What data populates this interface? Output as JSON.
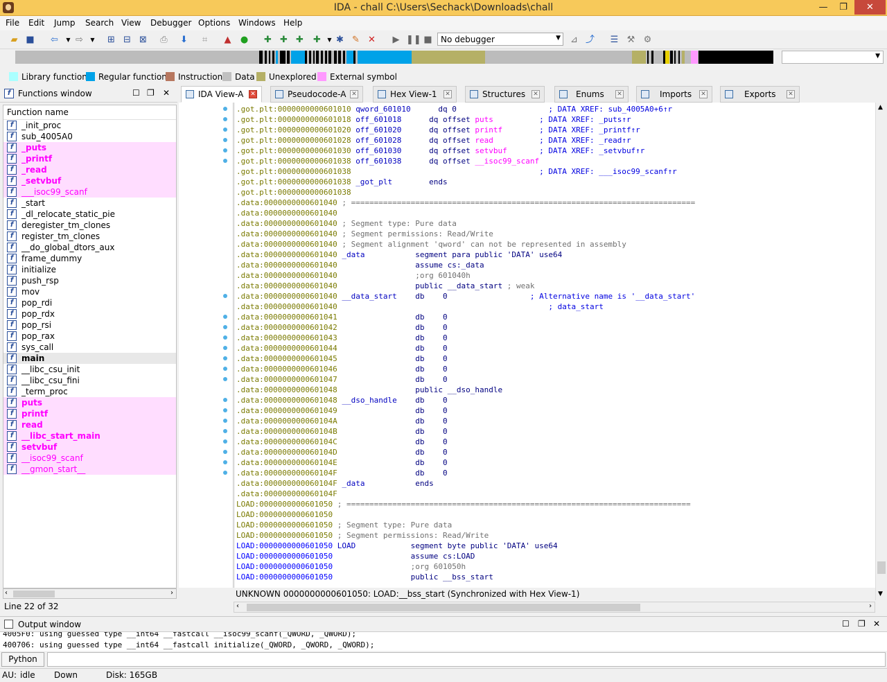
{
  "title": "IDA - chall C:\\Users\\Sechack\\Downloads\\chall",
  "window_buttons": {
    "minimize": "—",
    "maximize": "❐",
    "close": "✕"
  },
  "menu": [
    "File",
    "Edit",
    "Jump",
    "Search",
    "View",
    "Debugger",
    "Options",
    "Windows",
    "Help"
  ],
  "debugger_select": "No debugger",
  "legend": [
    {
      "label": "Library function",
      "color": "#aaffff"
    },
    {
      "label": "Regular function",
      "color": "#00a2e8"
    },
    {
      "label": "Instruction",
      "color": "#b7775f"
    },
    {
      "label": "Data",
      "color": "#c0c0c0"
    },
    {
      "label": "Unexplored",
      "color": "#b5b066"
    },
    {
      "label": "External symbol",
      "color": "#ff99ff"
    }
  ],
  "functions_window": {
    "title": "Functions window",
    "column": "Function name",
    "items": [
      {
        "name": "_init_proc",
        "kind": "reg"
      },
      {
        "name": "sub_4005A0",
        "kind": "reg"
      },
      {
        "name": "_puts",
        "kind": "ext"
      },
      {
        "name": "_printf",
        "kind": "ext"
      },
      {
        "name": "_read",
        "kind": "ext"
      },
      {
        "name": "_setvbuf",
        "kind": "ext"
      },
      {
        "name": "___isoc99_scanf",
        "kind": "ext"
      },
      {
        "name": "_start",
        "kind": "reg"
      },
      {
        "name": "_dl_relocate_static_pie",
        "kind": "reg"
      },
      {
        "name": "deregister_tm_clones",
        "kind": "reg"
      },
      {
        "name": "register_tm_clones",
        "kind": "reg"
      },
      {
        "name": "__do_global_dtors_aux",
        "kind": "reg"
      },
      {
        "name": "frame_dummy",
        "kind": "reg"
      },
      {
        "name": "initialize",
        "kind": "reg"
      },
      {
        "name": "push_rsp",
        "kind": "reg"
      },
      {
        "name": "mov",
        "kind": "reg"
      },
      {
        "name": "pop_rdi",
        "kind": "reg"
      },
      {
        "name": "pop_rdx",
        "kind": "reg"
      },
      {
        "name": "pop_rsi",
        "kind": "reg"
      },
      {
        "name": "pop_rax",
        "kind": "reg"
      },
      {
        "name": "sys_call",
        "kind": "reg"
      },
      {
        "name": "main",
        "kind": "sel"
      },
      {
        "name": "__libc_csu_init",
        "kind": "reg"
      },
      {
        "name": "__libc_csu_fini",
        "kind": "reg"
      },
      {
        "name": "_term_proc",
        "kind": "reg"
      },
      {
        "name": "puts",
        "kind": "ext"
      },
      {
        "name": "printf",
        "kind": "ext"
      },
      {
        "name": "read",
        "kind": "ext"
      },
      {
        "name": "__libc_start_main",
        "kind": "ext"
      },
      {
        "name": "setvbuf",
        "kind": "ext"
      },
      {
        "name": "__isoc99_scanf",
        "kind": "ext"
      },
      {
        "name": "__gmon_start__",
        "kind": "ext"
      }
    ],
    "status": "Line 22 of 32"
  },
  "tabs": [
    "IDA View-A",
    "Pseudocode-A",
    "Hex View-1",
    "Structures",
    "Enums",
    "Imports",
    "Exports"
  ],
  "disasm": [
    [
      ".got.plt:0000000000601010 ",
      "qword_601010",
      "      dq 0                    ",
      "; DATA XREF: sub_4005A0+6↑r"
    ],
    [
      ".got.plt:0000000000601018 ",
      "off_601018",
      "      dq offset puts          ",
      "; DATA XREF: _puts↑r"
    ],
    [
      ".got.plt:0000000000601020 ",
      "off_601020",
      "      dq offset printf        ",
      "; DATA XREF: _printf↑r"
    ],
    [
      ".got.plt:0000000000601028 ",
      "off_601028",
      "      dq offset read          ",
      "; DATA XREF: _read↑r"
    ],
    [
      ".got.plt:0000000000601030 ",
      "off_601030",
      "      dq offset setvbuf       ",
      "; DATA XREF: _setvbuf↑r"
    ],
    [
      ".got.plt:0000000000601038 ",
      "off_601038",
      "      dq offset __isoc99_scanf",
      ""
    ],
    [
      ".got.plt:0000000000601038 ",
      "",
      "                                        ",
      "; DATA XREF: ___isoc99_scanf↑r"
    ],
    [
      ".got.plt:0000000000601038 ",
      "_got_plt",
      "        ends",
      ""
    ],
    [
      ".got.plt:0000000000601038",
      "",
      "",
      ""
    ],
    [
      ".data:0000000000601040 ",
      "",
      "",
      "; ==========================================================================="
    ],
    [
      ".data:0000000000601040",
      "",
      "",
      ""
    ],
    [
      ".data:0000000000601040 ",
      "",
      "",
      "; Segment type: Pure data"
    ],
    [
      ".data:0000000000601040 ",
      "",
      "",
      "; Segment permissions: Read/Write"
    ],
    [
      ".data:0000000000601040 ",
      "",
      "",
      "; Segment alignment 'qword' can not be represented in assembly"
    ],
    [
      ".data:0000000000601040 ",
      "_data",
      "           segment para public 'DATA' use64",
      ""
    ],
    [
      ".data:0000000000601040 ",
      "",
      "                assume cs:_data",
      ""
    ],
    [
      ".data:0000000000601040 ",
      "",
      "                ",
      ";org 601040h"
    ],
    [
      ".data:0000000000601040 ",
      "",
      "                public __data_start ",
      "; weak"
    ],
    [
      ".data:0000000000601040 ",
      "__data_start",
      "    db    0                  ",
      "; Alternative name is '__data_start'"
    ],
    [
      ".data:0000000000601040 ",
      "",
      "                                             ",
      "; data_start"
    ],
    [
      ".data:0000000000601041 ",
      "",
      "                db    0",
      ""
    ],
    [
      ".data:0000000000601042 ",
      "",
      "                db    0",
      ""
    ],
    [
      ".data:0000000000601043 ",
      "",
      "                db    0",
      ""
    ],
    [
      ".data:0000000000601044 ",
      "",
      "                db    0",
      ""
    ],
    [
      ".data:0000000000601045 ",
      "",
      "                db    0",
      ""
    ],
    [
      ".data:0000000000601046 ",
      "",
      "                db    0",
      ""
    ],
    [
      ".data:0000000000601047 ",
      "",
      "                db    0",
      ""
    ],
    [
      ".data:0000000000601048 ",
      "",
      "                public __dso_handle",
      ""
    ],
    [
      ".data:0000000000601048 ",
      "__dso_handle",
      "    db    0",
      ""
    ],
    [
      ".data:0000000000601049 ",
      "",
      "                db    0",
      ""
    ],
    [
      ".data:000000000060104A ",
      "",
      "                db    0",
      ""
    ],
    [
      ".data:000000000060104B ",
      "",
      "                db    0",
      ""
    ],
    [
      ".data:000000000060104C ",
      "",
      "                db    0",
      ""
    ],
    [
      ".data:000000000060104D ",
      "",
      "                db    0",
      ""
    ],
    [
      ".data:000000000060104E ",
      "",
      "                db    0",
      ""
    ],
    [
      ".data:000000000060104F ",
      "",
      "                db    0",
      ""
    ],
    [
      ".data:000000000060104F ",
      "_data",
      "           ends",
      ""
    ],
    [
      ".data:000000000060104F",
      "",
      "",
      ""
    ],
    [
      "LOAD:0000000000601050 ",
      "",
      "",
      "; ==========================================================================="
    ],
    [
      "LOAD:0000000000601050",
      "",
      "",
      ""
    ],
    [
      "LOAD:0000000000601050 ",
      "",
      "",
      "; Segment type: Pure data"
    ],
    [
      "LOAD:0000000000601050 ",
      "",
      "",
      "; Segment permissions: Read/Write"
    ],
    [
      "LOAD:0000000000601050 ",
      "LOAD",
      "            segment byte public 'DATA' use64",
      ""
    ],
    [
      "LOAD:0000000000601050 ",
      "",
      "                assume cs:LOAD",
      ""
    ],
    [
      "LOAD:0000000000601050 ",
      "",
      "                ",
      ";org 601050h"
    ],
    [
      "LOAD:0000000000601050 ",
      "",
      "                public __bss_start",
      ""
    ]
  ],
  "sync_status": "UNKNOWN 0000000000601050: LOAD:__bss_start (Synchronized with Hex View-1)",
  "output_window": {
    "title": "Output window",
    "lines": [
      "4005F0: using guessed type __int64 __fastcall __isoc99_scanf(_QWORD, _QWORD);",
      "400706: using guessed type __int64 __fastcall initialize(_QWORD, _QWORD, _QWORD);"
    ]
  },
  "python_button": "Python",
  "status": {
    "au": "AU:",
    "state": "idle",
    "dir": "Down",
    "disk": "Disk: 165GB"
  }
}
